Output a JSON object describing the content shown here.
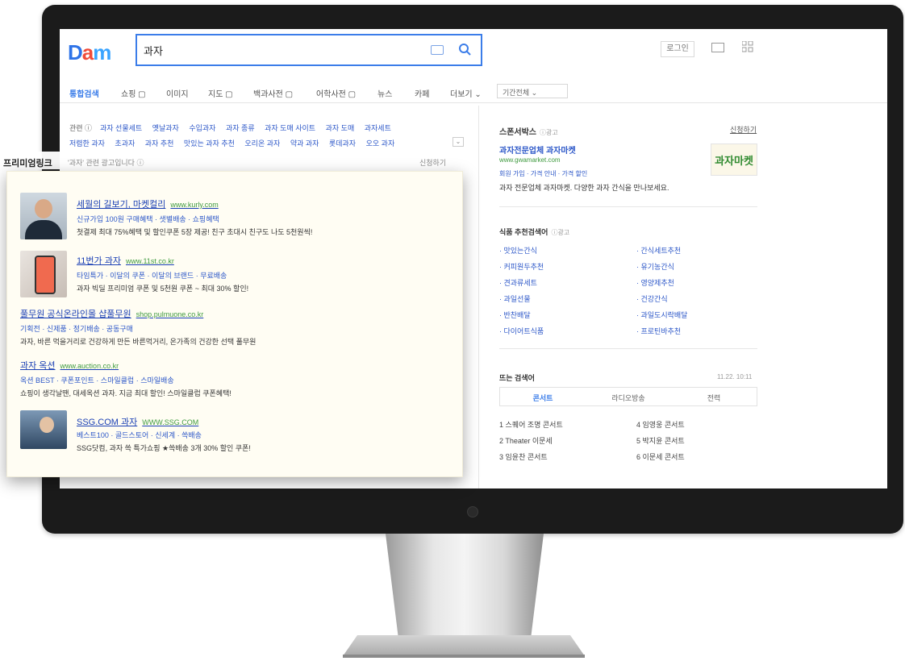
{
  "header": {
    "logo": {
      "part1": "D",
      "part2": "a",
      "part3": "m"
    },
    "search_value": "과자",
    "login_label": "로그인"
  },
  "tabs": {
    "items": [
      "통합검색",
      "쇼핑 ▢",
      "이미지",
      "지도 ▢",
      "백과사전 ▢",
      "어학사전 ▢",
      "뉴스",
      "카페",
      "더보기 ⌄"
    ],
    "period_select": "기간전체 ⌄"
  },
  "related": {
    "label": "관련 ⓘ",
    "row1": [
      "과자 선물세트",
      "옛날과자",
      "수입과자",
      "과자 종류",
      "과자 도매 사이트",
      "과자 도매",
      "과자세트"
    ],
    "row2": [
      "저렴한 과자",
      "초과자",
      "과자 추천",
      "맛있는 과자 추천",
      "오리온 과자",
      "약과 과자",
      "롯데과자",
      "오오 과자"
    ],
    "toggle": "⌄"
  },
  "premium": {
    "title": "프리미엄링크",
    "subtitle": "'과자' 관련 광고입니다 ⓘ",
    "apply": "신청하기",
    "ads": [
      {
        "title": "세월의 길보기, 마켓컬리",
        "url": "www.kurly.com",
        "tags": "신규가입 100원 구매혜택 · 샛별배송 · 쇼핑혜택",
        "desc": "첫결제 최대 75%혜택 및 할인쿠폰 5장 제공! 친구 초대시 친구도 나도 5천원씩!"
      },
      {
        "title": "11번가 과자",
        "url": "www.11st.co.kr",
        "tags": "타임특가 · 이달의 쿠폰 · 이달의 브랜드 · 무료배송",
        "desc": "과자 빅딜 프리미엄 쿠폰 및 5천원 쿠폰 ~ 최대 30% 할인!"
      },
      {
        "title": "풀무원 공식온라인몰 샵풀무원",
        "url": "shop.pulmuone.co.kr",
        "tags": "기획전 · 신제품 · 정기배송 · 공동구매",
        "desc": "과자, 바른 먹을거리로 건강하게 만든 바른먹거리, 온가족의 건강한 선택 풀무원"
      },
      {
        "title": "과자 옥션",
        "url": "www.auction.co.kr",
        "tags": "옥션 BEST · 쿠폰포인트 · 스마일클럽 · 스마일배송",
        "desc": "쇼핑이 생각날땐, 대세옥션 과자. 지금 최대 할인! 스마일클럽 쿠폰혜택!"
      },
      {
        "title": "SSG.COM 과자",
        "url": "WWW.SSG.COM",
        "tags": "베스트100 · 골드스토어 · 신세계 · 쓱배송",
        "desc": "SSG닷컴, 과자 쓱 특가쇼핑 ★쓱배송 3개 30% 할인 쿠폰!"
      }
    ]
  },
  "sponsor": {
    "title": "스폰서박스",
    "meta": "ⓘ광고",
    "apply": "신청하기",
    "site_title": "과자전문업체 과자마켓",
    "url": "www.gwamarket.com",
    "tags": "회원 가입 · 가격 안내 · 가격 할인",
    "desc": "과자 전문업체 과자마켓. 다양한 과자 간식을 만나보세요.",
    "logo_text": "과자마켓"
  },
  "food": {
    "title": "식품 추천검색어",
    "meta": "ⓘ광고",
    "items": [
      "· 맛있는간식",
      "· 간식세트추천",
      "· 커피원두추천",
      "· 유기농간식",
      "· 견과류세트",
      "· 영양제추천",
      "· 과일선물",
      "· 건강간식",
      "· 반찬배달",
      "· 과일도시락배달",
      "· 다이어트식품",
      "· 프로틴바추천"
    ]
  },
  "trending": {
    "title": "뜨는 검색어",
    "time": "11.22. 10:11",
    "tabs": [
      "콘서트",
      "라디오방송",
      "전력"
    ],
    "items": [
      "1 스퀘어 조명 콘서트",
      "2 Theater 이문세",
      "3 임윤찬 콘서트",
      "4 임영웅 콘서트",
      "5 박지윤 콘서트",
      "6 이문세 콘서트"
    ]
  },
  "colors": {
    "accent": "#3b7de9",
    "link": "#2c57c8",
    "url_green": "#3f9a3f",
    "bezel": "#1b1b1b"
  }
}
